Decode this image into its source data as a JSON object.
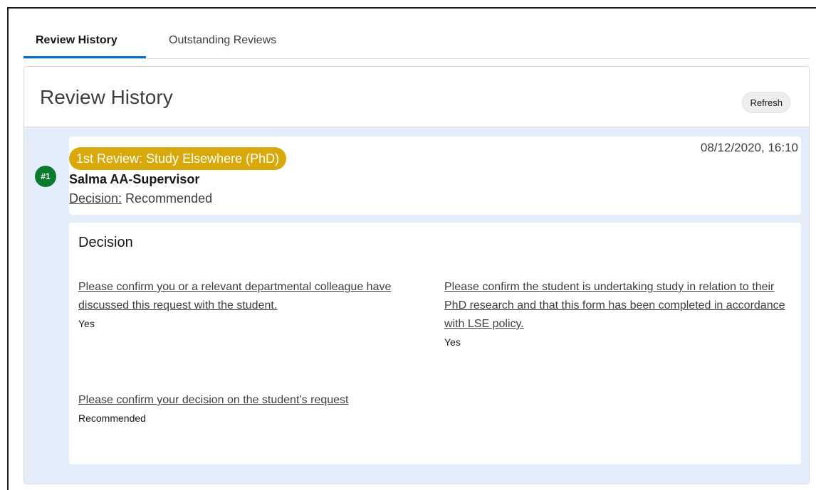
{
  "tabs": [
    {
      "label": "Review History",
      "active": true
    },
    {
      "label": "Outstanding Reviews",
      "active": false
    }
  ],
  "panel": {
    "title": "Review History",
    "refresh_label": "Refresh"
  },
  "review": {
    "number": "#1",
    "pill": "1st Review: Study Elsewhere (PhD)",
    "datetime": "08/12/2020, 16:10",
    "reviewer": "Salma AA-Supervisor",
    "decision_label": "Decision:",
    "decision_value": "Recommended"
  },
  "decision_section": {
    "title": "Decision",
    "fields": [
      {
        "question": "Please confirm you or a relevant departmental colleague have discussed this request with the student.",
        "answer": "Yes"
      },
      {
        "question": "Please confirm the student is undertaking study in relation to their PhD research and that this form has been completed in accordance with LSE policy.",
        "answer": "Yes"
      },
      {
        "question": "Please confirm your decision on the student’s request",
        "answer": "Recommended"
      }
    ]
  },
  "colors": {
    "tab_active_underline": "#0070d2",
    "pill_background": "#d9a90b",
    "number_badge": "#0a7a2f",
    "body_background": "#e4eefa"
  }
}
